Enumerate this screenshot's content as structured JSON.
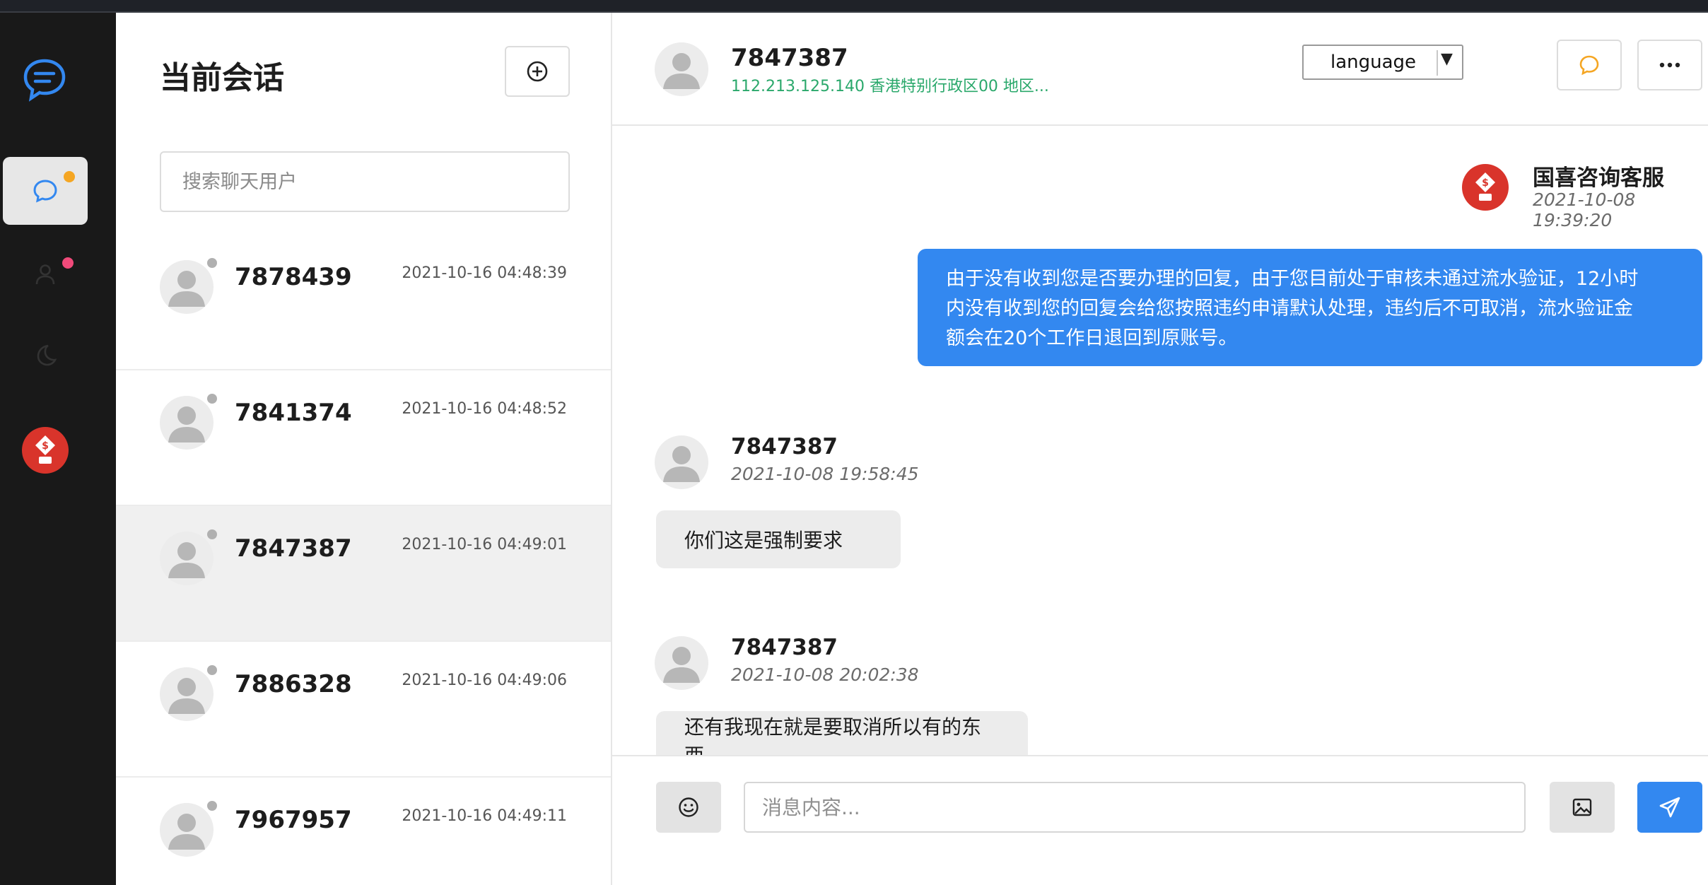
{
  "colors": {
    "accent": "#3388f0",
    "online_green": "#2aa86b",
    "unread_orange": "#f5a623",
    "unread_pink": "#f04a7a",
    "brand_red": "#d9342b"
  },
  "rail": {
    "icons": [
      "chat-logo-icon",
      "chat-bubble-icon",
      "user-icon",
      "moon-icon",
      "brand-avatar"
    ]
  },
  "list": {
    "title": "当前会话",
    "search_placeholder": "搜索聊天用户",
    "conversations": [
      {
        "name": "7878439",
        "time": "2021-10-16 04:48:39"
      },
      {
        "name": "7841374",
        "time": "2021-10-16 04:48:52"
      },
      {
        "name": "7847387",
        "time": "2021-10-16 04:49:01",
        "selected": true
      },
      {
        "name": "7886328",
        "time": "2021-10-16 04:49:06"
      },
      {
        "name": "7967957",
        "time": "2021-10-16 04:49:11"
      }
    ]
  },
  "chat": {
    "name": "7847387",
    "sub": "112.213.125.140 香港特别行政区00 地区...",
    "language_label": "language",
    "messages": [
      {
        "sender": "国喜咨询客服",
        "time": "2021-10-08 19:39:20",
        "lines": [
          "由于没有收到您是否要办理的回复，由于您目前处于审核未通过流水验证，12小时",
          "内没有收到您的回复会给您按照违约申请默认处理，违约后不可取消，流水验证金",
          "额会在20个工作日退回到原账号。"
        ]
      },
      {
        "sender": "7847387",
        "time": "2021-10-08 19:58:45",
        "text": "你们这是强制要求"
      },
      {
        "sender": "7847387",
        "time": "2021-10-08 20:02:38",
        "text": "还有我现在就是要取消所以有的东西"
      }
    ]
  },
  "composer": {
    "placeholder": "消息内容..."
  }
}
